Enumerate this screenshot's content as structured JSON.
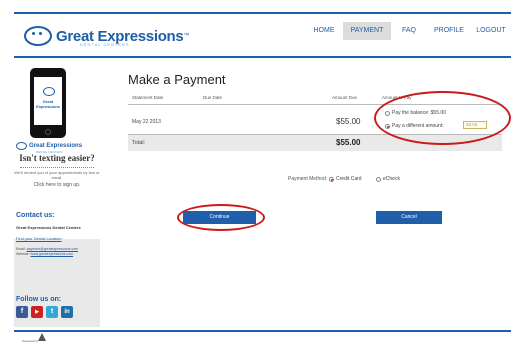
{
  "header": {
    "logo_text": "Great Expressions",
    "logo_tm": "™",
    "logo_sub": "DENTAL CENTERS",
    "nav": [
      {
        "label": "HOME",
        "active": false
      },
      {
        "label": "PAYMENT",
        "active": true
      },
      {
        "label": "FAQ",
        "active": false
      },
      {
        "label": "PROFILE",
        "active": false
      },
      {
        "label": "LOGOUT",
        "active": false
      }
    ]
  },
  "sidebar": {
    "phone_logo_text": "Great Expressions",
    "side_logo_text": "Great Expressions",
    "side_logo_sub": "DENTAL CENTERS",
    "texting_heading": "Isn't texting easier?",
    "texting_body": "We'll remind you of your appointments by text or email.",
    "signup_text": "Click here to sign up.",
    "contact_title": "Contact us:",
    "contact_org": "Great Expressions Dental Centers",
    "find_location": "Find your Dental Location",
    "email_label": "Email:",
    "email_value": "payment@greatexpressions.com",
    "website_label": "Website:",
    "website_value": "www.greatexpressions.com",
    "follow_title": "Follow us on:",
    "social": [
      {
        "name": "facebook",
        "glyph": "f",
        "color": "#3b5998"
      },
      {
        "name": "youtube",
        "glyph": "▶",
        "color": "#cc2222"
      },
      {
        "name": "twitter",
        "glyph": "t",
        "color": "#33a8d8"
      },
      {
        "name": "linkedin",
        "glyph": "in",
        "color": "#1f6fa8"
      }
    ]
  },
  "main": {
    "title": "Make a Payment",
    "columns": {
      "statement_date": "Statement Date",
      "due_date": "Due Date",
      "amount_due": "Amount Due",
      "amount_to_pay": "Amount to Pay"
    },
    "row": {
      "statement_date": "May 22 2013",
      "amount_due": "$55.00"
    },
    "total": {
      "label": "Total:",
      "amount": "$55.00"
    },
    "pay_options": {
      "balance_label": "Pay the balance: $55.00",
      "different_label": "Pay a different amount:",
      "different_value": "28.00",
      "selected": "different"
    },
    "payment_method": {
      "label": "Payment Method:",
      "options": [
        "Credit Card",
        "eCheck"
      ],
      "selected": "Credit Card"
    },
    "continue_label": "Continue",
    "cancel_label": "Cancel"
  },
  "footer": {
    "text": "Powered by"
  },
  "colors": {
    "brand_blue": "#1f5ea8",
    "annotation_red": "#cc1a1a",
    "sidebar_gray": "#e9e9e9"
  }
}
